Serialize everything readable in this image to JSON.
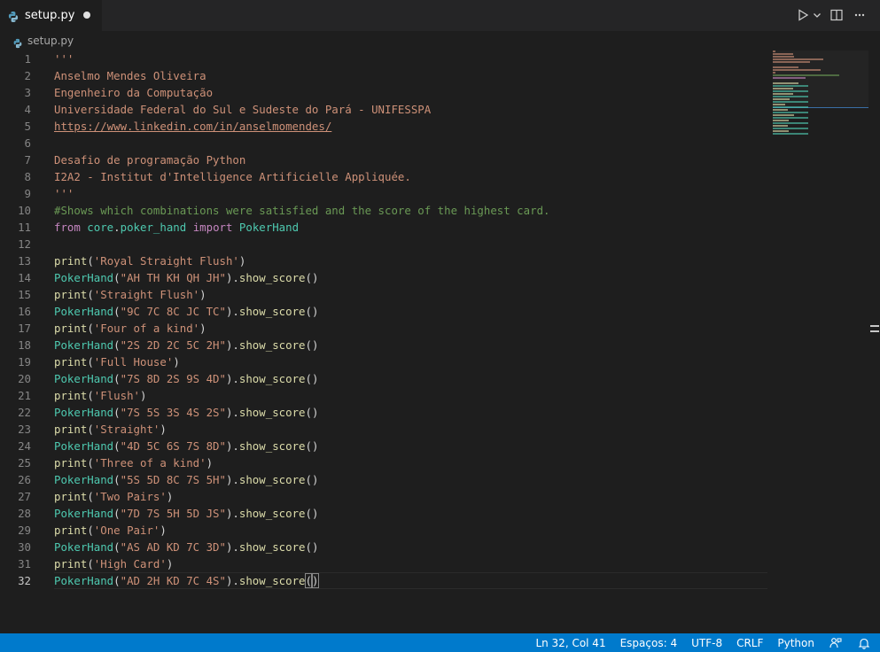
{
  "tab": {
    "title": "setup.py"
  },
  "breadcrumb": {
    "file": "setup.py"
  },
  "editor": {
    "active_line": 32,
    "lines": [
      [
        {
          "t": "'''",
          "c": "str"
        }
      ],
      [
        {
          "t": "Anselmo Mendes Oliveira",
          "c": "str"
        }
      ],
      [
        {
          "t": "Engenheiro da Computação",
          "c": "str"
        }
      ],
      [
        {
          "t": "Universidade Federal do Sul e Sudeste do Pará - UNIFESSPA",
          "c": "str"
        }
      ],
      [
        {
          "t": "https://www.linkedin.com/in/anselmomendes/",
          "c": "link"
        }
      ],
      [],
      [
        {
          "t": "Desafio de programação Python",
          "c": "str"
        }
      ],
      [
        {
          "t": "I2A2 - Institut d'Intelligence Artificielle Appliquée.",
          "c": "str"
        }
      ],
      [
        {
          "t": "'''",
          "c": "str"
        }
      ],
      [
        {
          "t": "#Shows which combinations were satisfied and the score of the highest card.",
          "c": "cmt"
        }
      ],
      [
        {
          "t": "from",
          "c": "kw"
        },
        {
          "t": " core",
          "c": "cls"
        },
        {
          "t": ".",
          "c": "plain"
        },
        {
          "t": "poker_hand",
          "c": "cls"
        },
        {
          "t": " ",
          "c": "plain"
        },
        {
          "t": "import",
          "c": "kw"
        },
        {
          "t": " PokerHand",
          "c": "cls"
        }
      ],
      [],
      [
        {
          "t": "print",
          "c": "fn"
        },
        {
          "t": "(",
          "c": "plain"
        },
        {
          "t": "'Royal Straight Flush'",
          "c": "str"
        },
        {
          "t": ")",
          "c": "plain"
        }
      ],
      [
        {
          "t": "PokerHand",
          "c": "cls"
        },
        {
          "t": "(",
          "c": "plain"
        },
        {
          "t": "\"AH TH KH QH JH\"",
          "c": "str"
        },
        {
          "t": ").",
          "c": "plain"
        },
        {
          "t": "show_score",
          "c": "fn"
        },
        {
          "t": "()",
          "c": "plain"
        }
      ],
      [
        {
          "t": "print",
          "c": "fn"
        },
        {
          "t": "(",
          "c": "plain"
        },
        {
          "t": "'Straight Flush'",
          "c": "str"
        },
        {
          "t": ")",
          "c": "plain"
        }
      ],
      [
        {
          "t": "PokerHand",
          "c": "cls"
        },
        {
          "t": "(",
          "c": "plain"
        },
        {
          "t": "\"9C 7C 8C JC TC\"",
          "c": "str"
        },
        {
          "t": ").",
          "c": "plain"
        },
        {
          "t": "show_score",
          "c": "fn"
        },
        {
          "t": "()",
          "c": "plain"
        }
      ],
      [
        {
          "t": "print",
          "c": "fn"
        },
        {
          "t": "(",
          "c": "plain"
        },
        {
          "t": "'Four of a kind'",
          "c": "str"
        },
        {
          "t": ")",
          "c": "plain"
        }
      ],
      [
        {
          "t": "PokerHand",
          "c": "cls"
        },
        {
          "t": "(",
          "c": "plain"
        },
        {
          "t": "\"2S 2D 2C 5C 2H\"",
          "c": "str"
        },
        {
          "t": ").",
          "c": "plain"
        },
        {
          "t": "show_score",
          "c": "fn"
        },
        {
          "t": "()",
          "c": "plain"
        }
      ],
      [
        {
          "t": "print",
          "c": "fn"
        },
        {
          "t": "(",
          "c": "plain"
        },
        {
          "t": "'Full House'",
          "c": "str"
        },
        {
          "t": ")",
          "c": "plain"
        }
      ],
      [
        {
          "t": "PokerHand",
          "c": "cls"
        },
        {
          "t": "(",
          "c": "plain"
        },
        {
          "t": "\"7S 8D 2S 9S 4D\"",
          "c": "str"
        },
        {
          "t": ").",
          "c": "plain"
        },
        {
          "t": "show_score",
          "c": "fn"
        },
        {
          "t": "()",
          "c": "plain"
        }
      ],
      [
        {
          "t": "print",
          "c": "fn"
        },
        {
          "t": "(",
          "c": "plain"
        },
        {
          "t": "'Flush'",
          "c": "str"
        },
        {
          "t": ")",
          "c": "plain"
        }
      ],
      [
        {
          "t": "PokerHand",
          "c": "cls"
        },
        {
          "t": "(",
          "c": "plain"
        },
        {
          "t": "\"7S 5S 3S 4S 2S\"",
          "c": "str"
        },
        {
          "t": ").",
          "c": "plain"
        },
        {
          "t": "show_score",
          "c": "fn"
        },
        {
          "t": "()",
          "c": "plain"
        }
      ],
      [
        {
          "t": "print",
          "c": "fn"
        },
        {
          "t": "(",
          "c": "plain"
        },
        {
          "t": "'Straight'",
          "c": "str"
        },
        {
          "t": ")",
          "c": "plain"
        }
      ],
      [
        {
          "t": "PokerHand",
          "c": "cls"
        },
        {
          "t": "(",
          "c": "plain"
        },
        {
          "t": "\"4D 5C 6S 7S 8D\"",
          "c": "str"
        },
        {
          "t": ").",
          "c": "plain"
        },
        {
          "t": "show_score",
          "c": "fn"
        },
        {
          "t": "()",
          "c": "plain"
        }
      ],
      [
        {
          "t": "print",
          "c": "fn"
        },
        {
          "t": "(",
          "c": "plain"
        },
        {
          "t": "'Three of a kind'",
          "c": "str"
        },
        {
          "t": ")",
          "c": "plain"
        }
      ],
      [
        {
          "t": "PokerHand",
          "c": "cls"
        },
        {
          "t": "(",
          "c": "plain"
        },
        {
          "t": "\"5S 5D 8C 7S 5H\"",
          "c": "str"
        },
        {
          "t": ").",
          "c": "plain"
        },
        {
          "t": "show_score",
          "c": "fn"
        },
        {
          "t": "()",
          "c": "plain"
        }
      ],
      [
        {
          "t": "print",
          "c": "fn"
        },
        {
          "t": "(",
          "c": "plain"
        },
        {
          "t": "'Two Pairs'",
          "c": "str"
        },
        {
          "t": ")",
          "c": "plain"
        }
      ],
      [
        {
          "t": "PokerHand",
          "c": "cls"
        },
        {
          "t": "(",
          "c": "plain"
        },
        {
          "t": "\"7D 7S 5H 5D JS\"",
          "c": "str"
        },
        {
          "t": ").",
          "c": "plain"
        },
        {
          "t": "show_score",
          "c": "fn"
        },
        {
          "t": "()",
          "c": "plain"
        }
      ],
      [
        {
          "t": "print",
          "c": "fn"
        },
        {
          "t": "(",
          "c": "plain"
        },
        {
          "t": "'One Pair'",
          "c": "str"
        },
        {
          "t": ")",
          "c": "plain"
        }
      ],
      [
        {
          "t": "PokerHand",
          "c": "cls"
        },
        {
          "t": "(",
          "c": "plain"
        },
        {
          "t": "\"AS AD KD 7C 3D\"",
          "c": "str"
        },
        {
          "t": ").",
          "c": "plain"
        },
        {
          "t": "show_score",
          "c": "fn"
        },
        {
          "t": "()",
          "c": "plain"
        }
      ],
      [
        {
          "t": "print",
          "c": "fn"
        },
        {
          "t": "(",
          "c": "plain"
        },
        {
          "t": "'High Card'",
          "c": "str"
        },
        {
          "t": ")",
          "c": "plain"
        }
      ],
      [
        {
          "t": "PokerHand",
          "c": "cls"
        },
        {
          "t": "(",
          "c": "plain"
        },
        {
          "t": "\"AD 2H KD 7C 4S\"",
          "c": "str"
        },
        {
          "t": ").",
          "c": "plain"
        },
        {
          "t": "show_score",
          "c": "fn"
        },
        {
          "t": "(",
          "c": "bracket"
        },
        {
          "t": ")",
          "c": "bracket"
        }
      ]
    ]
  },
  "statusbar": {
    "position": "Ln 32, Col 41",
    "indent": "Espaços: 4",
    "encoding": "UTF-8",
    "eol": "CRLF",
    "language": "Python"
  },
  "colors": {
    "statusbar": "#007acc",
    "editor_bg": "#1e1e1e",
    "string": "#ce9178",
    "comment": "#6a9955",
    "keyword": "#c586c0",
    "function": "#dcdcaa",
    "class": "#4ec9b0"
  }
}
